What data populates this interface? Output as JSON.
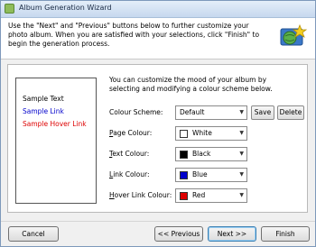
{
  "window": {
    "title": "Album Generation Wizard"
  },
  "header": {
    "text": "Use the \"Next\" and \"Previous\" buttons below to further customize your photo album. When you are satisfied with your selections, click \"Finish\" to begin the generation process."
  },
  "preview": {
    "text": "Sample Text",
    "link": "Sample Link",
    "hover_link": "Sample Hover Link"
  },
  "main": {
    "description": "You can customize the mood of your album by selecting and modifying a colour scheme below.",
    "scheme_label": "Colour Scheme:",
    "scheme_value": "Default",
    "save_label": "Save",
    "delete_label": "Delete",
    "rows": [
      {
        "label_pre": "",
        "label_key": "P",
        "label_post": "age Colour:",
        "value": "White",
        "swatch": "#ffffff"
      },
      {
        "label_pre": "",
        "label_key": "T",
        "label_post": "ext Colour:",
        "value": "Black",
        "swatch": "#000000"
      },
      {
        "label_pre": "",
        "label_key": "L",
        "label_post": "ink Colour:",
        "value": "Blue",
        "swatch": "#0000cc"
      },
      {
        "label_pre": "",
        "label_key": "H",
        "label_post": "over Link Colour:",
        "value": "Red",
        "swatch": "#dd0000"
      }
    ]
  },
  "footer": {
    "cancel_label": "Cancel",
    "previous_label": "<< Previous",
    "next_label": "Next >>",
    "finish_label": "Finish"
  },
  "colors": {
    "link": "#0000cc",
    "hover_link": "#dd0000",
    "text": "#000000"
  }
}
